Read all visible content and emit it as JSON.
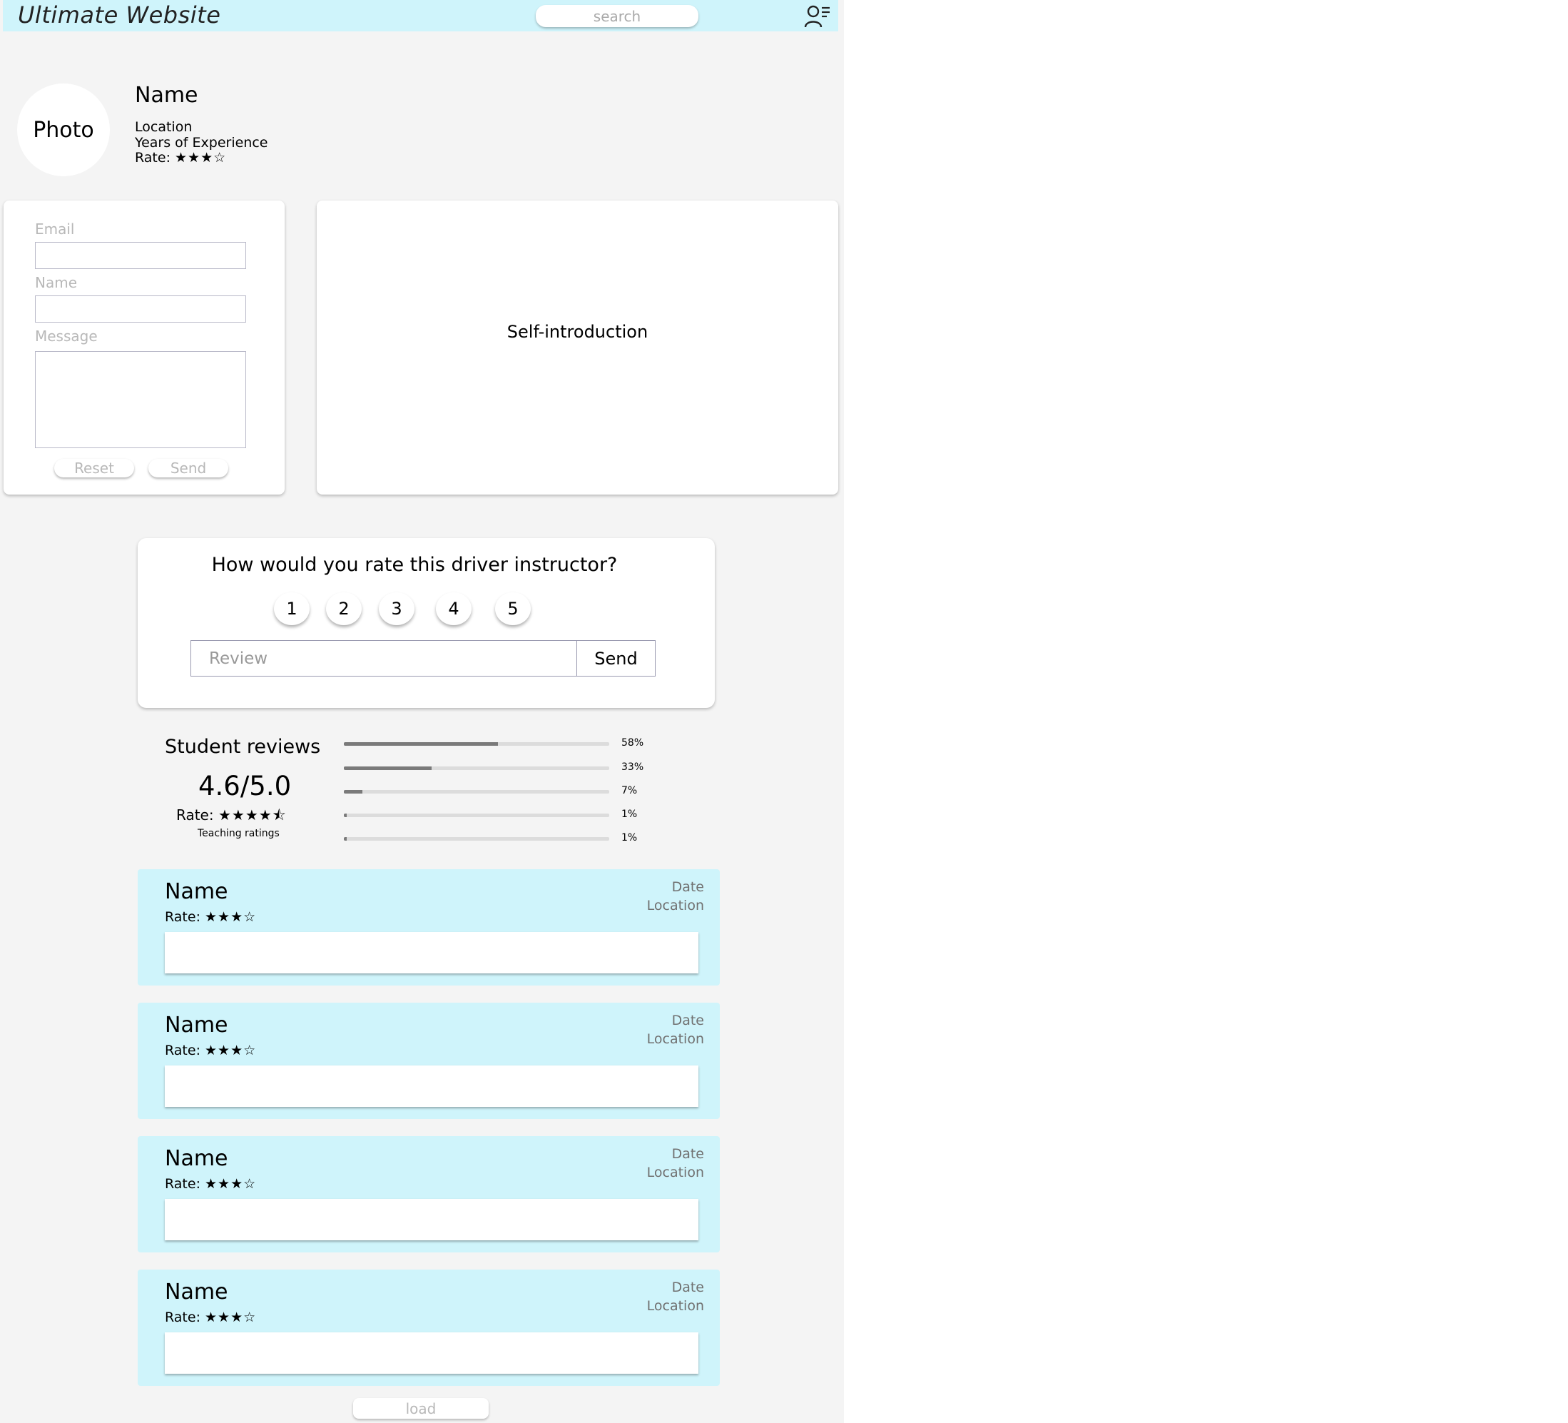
{
  "header": {
    "title": "Ultimate Website",
    "search_placeholder": "search",
    "user_icon": "user-menu-icon"
  },
  "profile": {
    "photo_label": "Photo",
    "name": "Name",
    "location": "Location",
    "years": "Years of Experience",
    "rate_label": "Rate:",
    "rate_stars": "★★★☆"
  },
  "contact_form": {
    "email_label": "Email",
    "name_label": "Name",
    "message_label": "Message",
    "reset_label": "Reset",
    "send_label": "Send"
  },
  "intro": {
    "text": "Self-introduction"
  },
  "rating": {
    "question": "How would you rate this driver instructor?",
    "options": [
      "1",
      "2",
      "3",
      "4",
      "5"
    ],
    "review_placeholder": "Review",
    "send_label": "Send"
  },
  "summary": {
    "heading": "Student reviews",
    "score": "4.6/5.0",
    "rate_label": "Rate:",
    "rate_stars": "★★★★⯪",
    "caption": "Teaching ratings",
    "distribution": [
      {
        "label": "58%",
        "value": 58
      },
      {
        "label": "33%",
        "value": 33
      },
      {
        "label": "7%",
        "value": 7
      },
      {
        "label": "1%",
        "value": 1
      },
      {
        "label": "1%",
        "value": 1
      }
    ]
  },
  "reviews": [
    {
      "name": "Name",
      "rate_label": "Rate:",
      "stars": "★★★☆",
      "date": "Date",
      "location": "Location"
    },
    {
      "name": "Name",
      "rate_label": "Rate:",
      "stars": "★★★☆",
      "date": "Date",
      "location": "Location"
    },
    {
      "name": "Name",
      "rate_label": "Rate:",
      "stars": "★★★☆",
      "date": "Date",
      "location": "Location"
    },
    {
      "name": "Name",
      "rate_label": "Rate:",
      "stars": "★★★☆",
      "date": "Date",
      "location": "Location"
    }
  ],
  "load_label": "load",
  "colors": {
    "header_bg": "#cff4fb",
    "page_bg": "#f4f4f4",
    "bar_fill": "#7a7a7a",
    "bar_track": "#dcdcdc"
  }
}
